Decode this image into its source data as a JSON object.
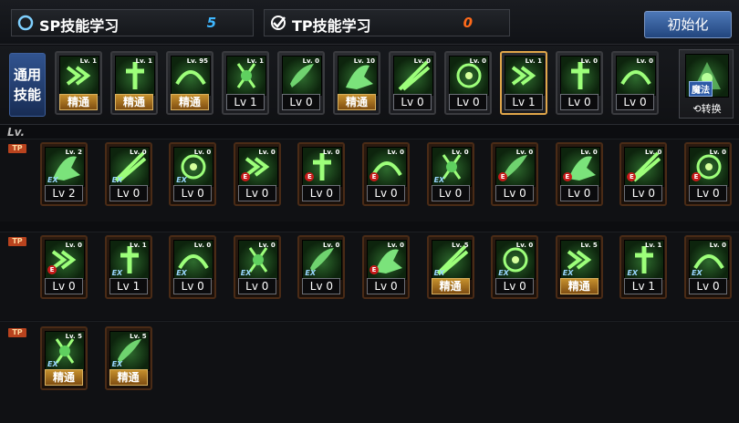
{
  "points": {
    "sp_label": "SP技能学习",
    "sp_value": "5",
    "tp_label": "TP技能学习",
    "tp_value": "0"
  },
  "reset_label": "初始化",
  "common": {
    "label_line1": "通用",
    "label_line2": "技能",
    "switch_badge": "魔法",
    "switch_label": "转换",
    "skills": [
      {
        "mini": "Lv. 1",
        "level": "精通",
        "master": true
      },
      {
        "mini": "Lv. 1",
        "level": "精通",
        "master": true
      },
      {
        "mini": "Lv. 95",
        "level": "精通",
        "master": true
      },
      {
        "mini": "Lv. 1",
        "level": "Lv 1",
        "master": false
      },
      {
        "mini": "Lv. 0",
        "level": "Lv 0",
        "master": false
      },
      {
        "mini": "Lv. 10",
        "level": "精通",
        "master": true
      },
      {
        "mini": "Lv. 0",
        "level": "Lv 0",
        "master": false
      },
      {
        "mini": "Lv. 0",
        "level": "Lv 0",
        "master": false
      },
      {
        "mini": "Lv. 1",
        "level": "Lv 1",
        "master": false,
        "selected": true
      },
      {
        "mini": "Lv. 0",
        "level": "Lv 0",
        "master": false
      },
      {
        "mini": "Lv. 0",
        "level": "Lv 0",
        "master": false
      }
    ]
  },
  "lv_tag": "Lv.",
  "tp_tag": "TP",
  "rows": [
    [
      {
        "mini": "Lv. 2",
        "level": "Lv 2",
        "badge": "ex"
      },
      {
        "mini": "Lv. 0",
        "level": "Lv 0",
        "badge": "ex"
      },
      {
        "mini": "Lv. 0",
        "level": "Lv 0",
        "badge": "ex"
      },
      {
        "mini": "Lv. 0",
        "level": "Lv 0",
        "badge": "red"
      },
      {
        "mini": "Lv. 0",
        "level": "Lv 0",
        "badge": "red"
      },
      {
        "mini": "Lv. 0",
        "level": "Lv 0",
        "badge": "red"
      },
      {
        "mini": "Lv. 0",
        "level": "Lv 0",
        "badge": "ex"
      },
      {
        "mini": "Lv. 0",
        "level": "Lv 0",
        "badge": "red"
      },
      {
        "mini": "Lv. 0",
        "level": "Lv 0",
        "badge": "red"
      },
      {
        "mini": "Lv. 0",
        "level": "Lv 0",
        "badge": "red"
      },
      {
        "mini": "Lv. 0",
        "level": "Lv 0",
        "badge": "red"
      }
    ],
    [
      {
        "mini": "Lv. 0",
        "level": "Lv 0",
        "badge": "red"
      },
      {
        "mini": "Lv. 1",
        "level": "Lv 1",
        "badge": "ex"
      },
      {
        "mini": "Lv. 0",
        "level": "Lv 0",
        "badge": "ex"
      },
      {
        "mini": "Lv. 0",
        "level": "Lv 0",
        "badge": "ex"
      },
      {
        "mini": "Lv. 0",
        "level": "Lv 0",
        "badge": "ex"
      },
      {
        "mini": "Lv. 0",
        "level": "Lv 0",
        "badge": "red"
      },
      {
        "mini": "Lv. 5",
        "level": "精通",
        "badge": "ex",
        "master": true
      },
      {
        "mini": "Lv. 0",
        "level": "Lv 0",
        "badge": "ex"
      },
      {
        "mini": "Lv. 5",
        "level": "精通",
        "badge": "ex",
        "master": true
      },
      {
        "mini": "Lv. 1",
        "level": "Lv 1",
        "badge": "ex"
      },
      {
        "mini": "Lv. 0",
        "level": "Lv 0",
        "badge": "ex"
      }
    ],
    [
      {
        "mini": "Lv. 5",
        "level": "精通",
        "badge": "ex",
        "master": true
      },
      {
        "mini": "Lv. 5",
        "level": "精通",
        "badge": "ex",
        "master": true
      }
    ]
  ],
  "ex_badge_text": "EX",
  "red_badge_text": "E",
  "colors": {
    "sp_accent": "#3fb7ff",
    "tp_accent": "#ff6a1a",
    "reset_blue": "#2e5a9c",
    "master_gold": "#c6902d",
    "slot_border": "#4a2b16"
  }
}
